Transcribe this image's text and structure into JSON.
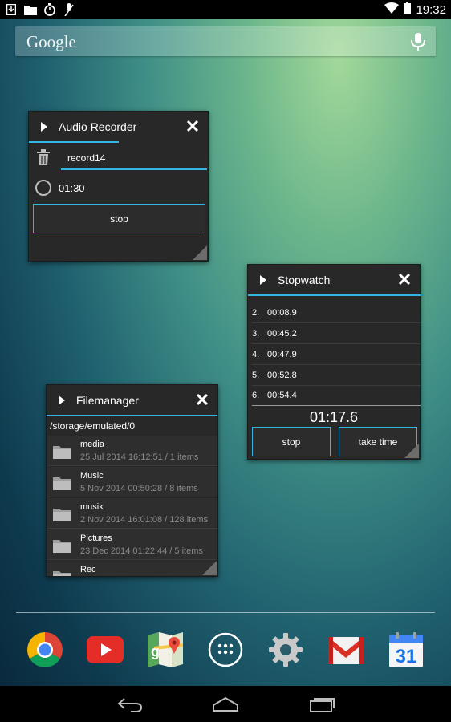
{
  "status_bar": {
    "time": "19:32",
    "left_icons": [
      "download-icon",
      "folder-icon",
      "stopwatch-icon",
      "mic-off-icon"
    ],
    "right_icons": [
      "wifi-icon",
      "battery-icon"
    ]
  },
  "search": {
    "logo": "Google",
    "icon": "mic-icon"
  },
  "audio_recorder": {
    "title": "Audio Recorder",
    "filename": "record14",
    "elapsed": "01:30",
    "stop_label": "stop"
  },
  "stopwatch": {
    "title": "Stopwatch",
    "laps": [
      {
        "index": "2.",
        "time": "00:08.9"
      },
      {
        "index": "3.",
        "time": "00:45.2"
      },
      {
        "index": "4.",
        "time": "00:47.9"
      },
      {
        "index": "5.",
        "time": "00:52.8"
      },
      {
        "index": "6.",
        "time": "00:54.4"
      }
    ],
    "total": "01:17.6",
    "stop_label": "stop",
    "take_time_label": "take time"
  },
  "filemanager": {
    "title": "Filemanager",
    "path": "/storage/emulated/0",
    "items": [
      {
        "name": "media",
        "meta": "25 Jul 2014 16:12:51 / 1 items"
      },
      {
        "name": "Music",
        "meta": "5 Nov 2014 00:50:28 / 8 items"
      },
      {
        "name": "musik",
        "meta": "2 Nov 2014 16:01:08 / 128 items"
      },
      {
        "name": "Pictures",
        "meta": "23 Dec 2014 01:22:44 / 5 items"
      },
      {
        "name": "Rec",
        "meta": ""
      }
    ]
  },
  "dock": {
    "apps": [
      "chrome-icon",
      "youtube-icon",
      "maps-icon",
      "app-drawer-icon",
      "settings-icon",
      "gmail-icon",
      "calendar-icon"
    ],
    "calendar_day": "31"
  },
  "nav": {
    "buttons": [
      "back-icon",
      "home-icon",
      "recents-icon"
    ]
  },
  "colors": {
    "accent": "#33b5e5",
    "widget_bg": "#282828"
  }
}
